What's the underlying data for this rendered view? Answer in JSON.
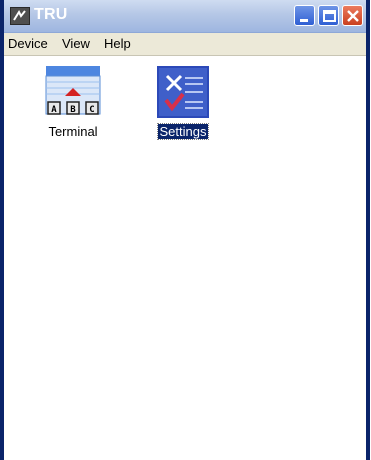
{
  "window": {
    "title": "TRU",
    "icon": "app-icon",
    "controls": [
      "minimize-icon",
      "maximize-icon",
      "close-icon"
    ]
  },
  "menubar": {
    "items": [
      "Device",
      "View",
      "Help"
    ]
  },
  "desktop": {
    "items": [
      {
        "label": "Terminal",
        "icon": "terminal-icon",
        "selected": false
      },
      {
        "label": "Settings",
        "icon": "settings-icon",
        "selected": true
      }
    ]
  },
  "colors": {
    "titlebar": "#b5c7e6",
    "selection": "#0a246a",
    "menubar": "#ece9d8",
    "close_button": "#c94020",
    "window_button": "#2f5fd4"
  }
}
